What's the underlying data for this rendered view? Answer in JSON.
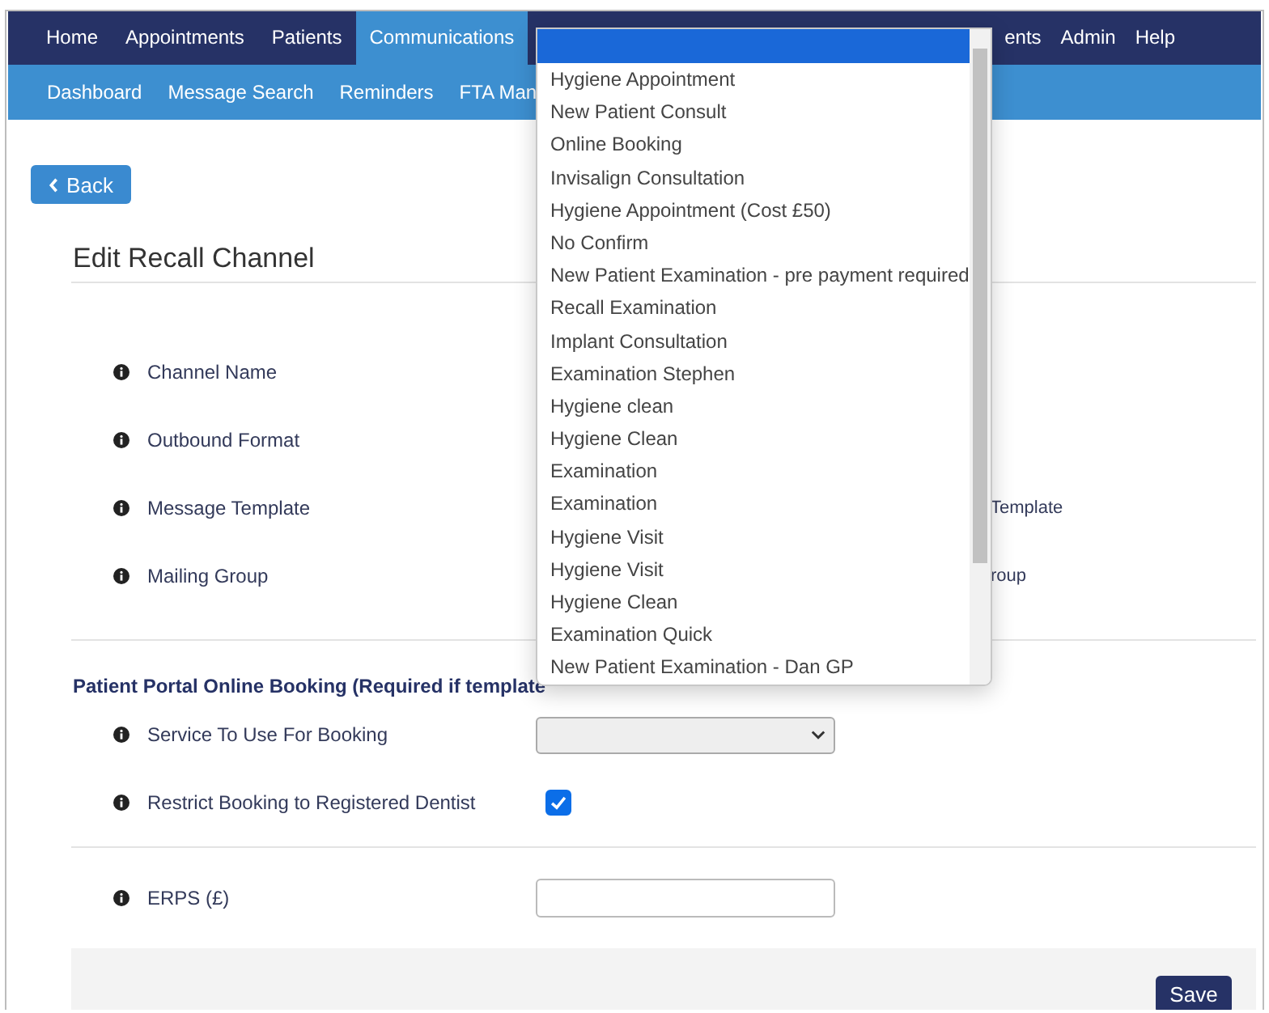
{
  "nav": {
    "items": [
      {
        "label": "Home",
        "selected": false
      },
      {
        "label": "Appointments",
        "selected": false
      },
      {
        "label": "Patients",
        "selected": false
      },
      {
        "label": "Communications",
        "selected": true
      }
    ],
    "trailing_items": [
      {
        "label": "ents",
        "selected": false
      },
      {
        "label": "Admin",
        "selected": false
      },
      {
        "label": "Help",
        "selected": false
      }
    ]
  },
  "subnav": {
    "items": [
      {
        "label": "Dashboard"
      },
      {
        "label": "Message Search"
      },
      {
        "label": "Reminders"
      },
      {
        "label": "FTA Man"
      }
    ]
  },
  "back_button": {
    "label": "Back"
  },
  "heading": "Edit Recall Channel",
  "fields": [
    {
      "label": "Channel Name"
    },
    {
      "label": "Outbound Format"
    },
    {
      "label": "Message Template",
      "trailing": "Template"
    },
    {
      "label": "Mailing Group",
      "trailing": "roup"
    }
  ],
  "booking_section": {
    "title": "Patient Portal Online Booking (Required if template",
    "fields": [
      {
        "label": "Service To Use For Booking",
        "kind": "select"
      },
      {
        "label": "Restrict Booking to Registered Dentist",
        "kind": "checkbox",
        "checked": true
      }
    ]
  },
  "extra_fields": [
    {
      "label": "ERPS (£)",
      "kind": "text"
    }
  ],
  "save_button": {
    "label": "Save"
  },
  "dropdown": {
    "options": [
      {
        "selected": true
      },
      {
        "label": "Hygiene Appointment",
        "selected": false
      },
      {
        "label": "New Patient Consult",
        "selected": false
      },
      {
        "label": "Online Booking",
        "selected": false
      },
      {
        "label": "Invisalign Consultation",
        "selected": false
      },
      {
        "label": "Hygiene Appointment (Cost £50)",
        "selected": false
      },
      {
        "label": "No Confirm",
        "selected": false
      },
      {
        "label": "New Patient Examination - pre payment required",
        "selected": false
      },
      {
        "label": "Recall Examination",
        "selected": false
      },
      {
        "label": "Implant Consultation",
        "selected": false
      },
      {
        "label": "Examination Stephen",
        "selected": false
      },
      {
        "label": "Hygiene clean",
        "selected": false
      },
      {
        "label": "Hygiene Clean",
        "selected": false
      },
      {
        "label": "Examination",
        "selected": false
      },
      {
        "label": "Examination",
        "selected": false
      },
      {
        "label": "Hygiene Visit",
        "selected": false
      },
      {
        "label": "Hygiene Visit",
        "selected": false
      },
      {
        "label": "Hygiene Clean",
        "selected": false
      },
      {
        "label": "Examination Quick",
        "selected": false
      },
      {
        "label": "New Patient Examination - Dan GP",
        "selected": false
      }
    ]
  }
}
